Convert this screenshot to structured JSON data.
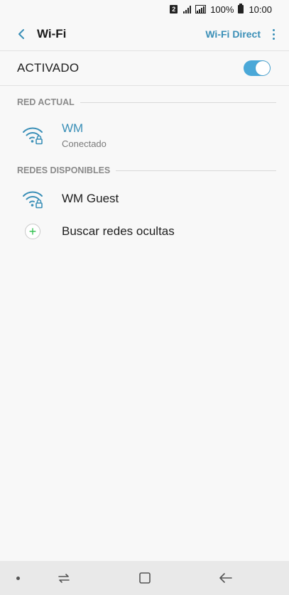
{
  "status_bar": {
    "sim_slot": "2",
    "battery_percent": "100%",
    "time": "10:00"
  },
  "app_bar": {
    "title": "Wi-Fi",
    "wifi_direct_label": "Wi-Fi Direct"
  },
  "master_switch": {
    "label": "ACTIVADO",
    "enabled": true
  },
  "current_network": {
    "header": "RED ACTUAL",
    "name": "WM",
    "status": "Conectado"
  },
  "available_networks": {
    "header": "REDES DISPONIBLES",
    "items": [
      {
        "name": "WM Guest"
      }
    ],
    "search_hidden_label": "Buscar redes ocultas"
  },
  "colors": {
    "accent": "#3a8fb7",
    "toggle_on": "#4aa8d8",
    "add_icon": "#2bbf4a",
    "wifi_icon": "#3a8fb7"
  }
}
